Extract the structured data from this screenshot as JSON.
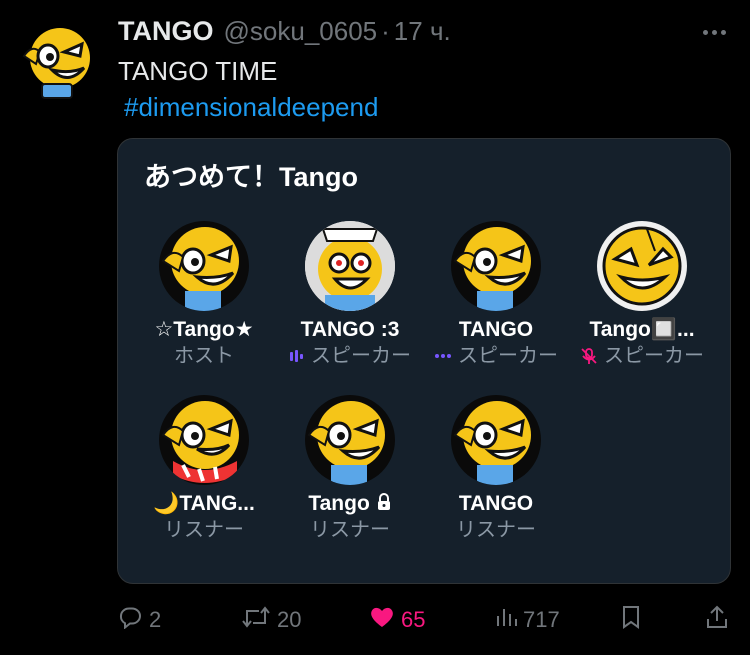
{
  "tweet": {
    "display_name": "TANGO",
    "handle": "@soku_0605",
    "separator": "·",
    "time": "17 ч.",
    "text": "TANGO TIME",
    "hashtag": "#dimensionaldeepend"
  },
  "space": {
    "title": "あつめて！Tango",
    "participants": [
      {
        "name": "☆Tango★",
        "role": "ホスト",
        "role_icon": "none"
      },
      {
        "name": "TANGO :3",
        "role": "スピーカー",
        "role_icon": "speaking-bars-icon"
      },
      {
        "name": "TANGO",
        "role": "スピーカー",
        "role_icon": "dots-icon"
      },
      {
        "name": "Tango🔲...",
        "role": "スピーカー",
        "role_icon": "muted-mic-icon"
      },
      {
        "name": "🌙TANG...",
        "role": "リスナー",
        "role_icon": "none"
      },
      {
        "name": "Tango",
        "role": "リスナー",
        "role_icon": "none",
        "lock": true
      },
      {
        "name": "TANGO",
        "role": "リスナー",
        "role_icon": "none"
      }
    ]
  },
  "actions": {
    "replies": "2",
    "retweets": "20",
    "likes": "65",
    "views": "717"
  },
  "colors": {
    "background": "#000000",
    "card": "#15202b",
    "accent": "#1d9bf0",
    "like": "#f91880",
    "speaker_purple": "#7856ff",
    "muted_pink": "#f91880",
    "avatar_yellow": "#f5c518"
  }
}
